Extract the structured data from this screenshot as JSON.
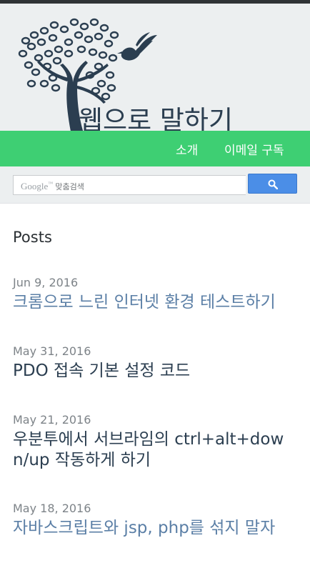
{
  "site": {
    "title": "웹으로 말하기",
    "logo_icon": "tree-bird-logo-icon"
  },
  "nav": {
    "items": [
      {
        "label": "소개"
      },
      {
        "label": "이메일 구독"
      }
    ]
  },
  "search": {
    "brand": "Google",
    "brand_tm": "™",
    "placeholder": "맞춤검색",
    "button_icon": "search-icon"
  },
  "main": {
    "heading": "Posts",
    "posts": [
      {
        "date": "Jun 9, 2016",
        "title": "크롬으로 느린 인터넷 환경 테스트하기",
        "style": "link"
      },
      {
        "date": "May 31, 2016",
        "title": "PDO 접속 기본 설정 코드",
        "style": "dark"
      },
      {
        "date": "May 21, 2016",
        "title": "우분투에서 서브라임의 ctrl+alt+down/up 작동하게 하기",
        "style": "dark"
      },
      {
        "date": "May 18, 2016",
        "title": "자바스크립트와 jsp, php를 섞지 말자",
        "style": "link"
      }
    ]
  },
  "colors": {
    "nav_bg": "#3ecf73",
    "header_bg": "#eceff0",
    "link": "#5b7fa6",
    "title_dark": "#2b3e50",
    "search_button": "#4b8ee7"
  }
}
